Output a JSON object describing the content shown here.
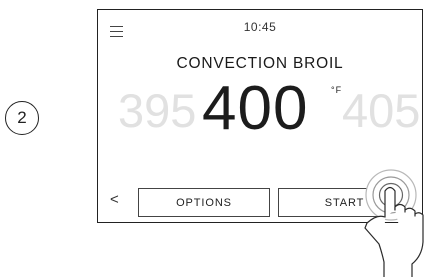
{
  "step": {
    "number": "2"
  },
  "status_bar": {
    "time": "10:45",
    "menu_icon": "hamburger-menu-icon"
  },
  "mode": {
    "title": "CONVECTION BROIL"
  },
  "temperature": {
    "previous": "395",
    "current": "400",
    "next": "405",
    "unit": "°F"
  },
  "controls": {
    "back_icon": "chevron-left-icon",
    "back_glyph": "<",
    "options_label": "OPTIONS",
    "start_label": "START"
  },
  "overlay": {
    "gesture_icon": "tapping-hand-icon"
  }
}
